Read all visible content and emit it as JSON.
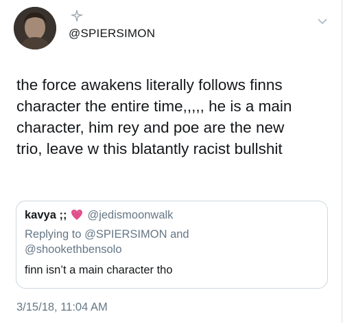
{
  "author": {
    "handle": "@SPIERSIMON",
    "avatar_icon": "user-avatar",
    "badge_icon": "sparkle-icon"
  },
  "tweet": {
    "text": "the force awakens literally follows finns\ncharacter the entire time,,,,, he is a main\ncharacter, him rey and poe are the new\ntrio, leave w this blatantly racist bullshit",
    "timestamp": "3/15/18, 11:04 AM"
  },
  "quote": {
    "name": "kavya ;;",
    "emoji_icon": "sparkling-heart-icon",
    "handle": "@jedismoonwalk",
    "reply_line": "Replying to @SPIERSIMON and\n@shookethbensolo",
    "text": "finn isn’t a main character tho"
  },
  "colors": {
    "text": "#14171a",
    "secondary": "#657786",
    "border": "#ccd6dd",
    "heart": "#e0518c"
  },
  "menu_icon": "chevron-down-icon"
}
